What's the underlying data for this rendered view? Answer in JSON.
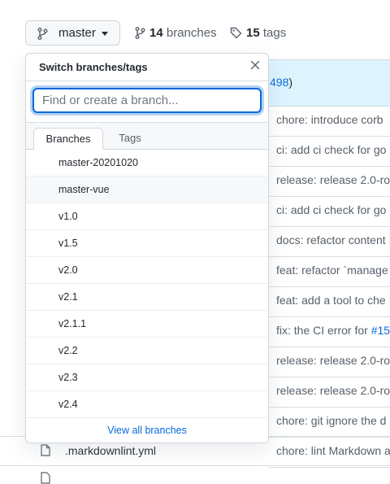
{
  "toolbar": {
    "branch_label": "master",
    "branches_count": "14",
    "branches_word": "branches",
    "tags_count": "15",
    "tags_word": "tags"
  },
  "commit_banner": {
    "pr_number": "498",
    "close_paren": ")"
  },
  "commits": [
    {
      "text": "chore: introduce corb"
    },
    {
      "text": "ci: add ci check for go"
    },
    {
      "text": "release: release 2.0-ro"
    },
    {
      "text": "ci: add ci check for go"
    },
    {
      "text": "docs: refactor content"
    },
    {
      "text": "feat: refactor `manage"
    },
    {
      "text": "feat: add a tool to che"
    },
    {
      "text": "fix: the CI error for ",
      "link": "#15"
    },
    {
      "text": "release: release 2.0-ro"
    },
    {
      "text": "release: release 2.0-ro"
    },
    {
      "text": "chore: git ignore the d"
    },
    {
      "text": "chore: lint Markdown a"
    }
  ],
  "files": [
    {
      "name": ".markdownlint.yml"
    }
  ],
  "dropdown": {
    "title": "Switch branches/tags",
    "search_placeholder": "Find or create a branch...",
    "tabs": [
      {
        "label": "Branches",
        "active": true
      },
      {
        "label": "Tags",
        "active": false
      }
    ],
    "branches": [
      "master-20201020",
      "master-vue",
      "v1.0",
      "v1.5",
      "v2.0",
      "v2.1",
      "v2.1.1",
      "v2.2",
      "v2.3",
      "v2.4"
    ],
    "footer_link": "View all branches"
  }
}
